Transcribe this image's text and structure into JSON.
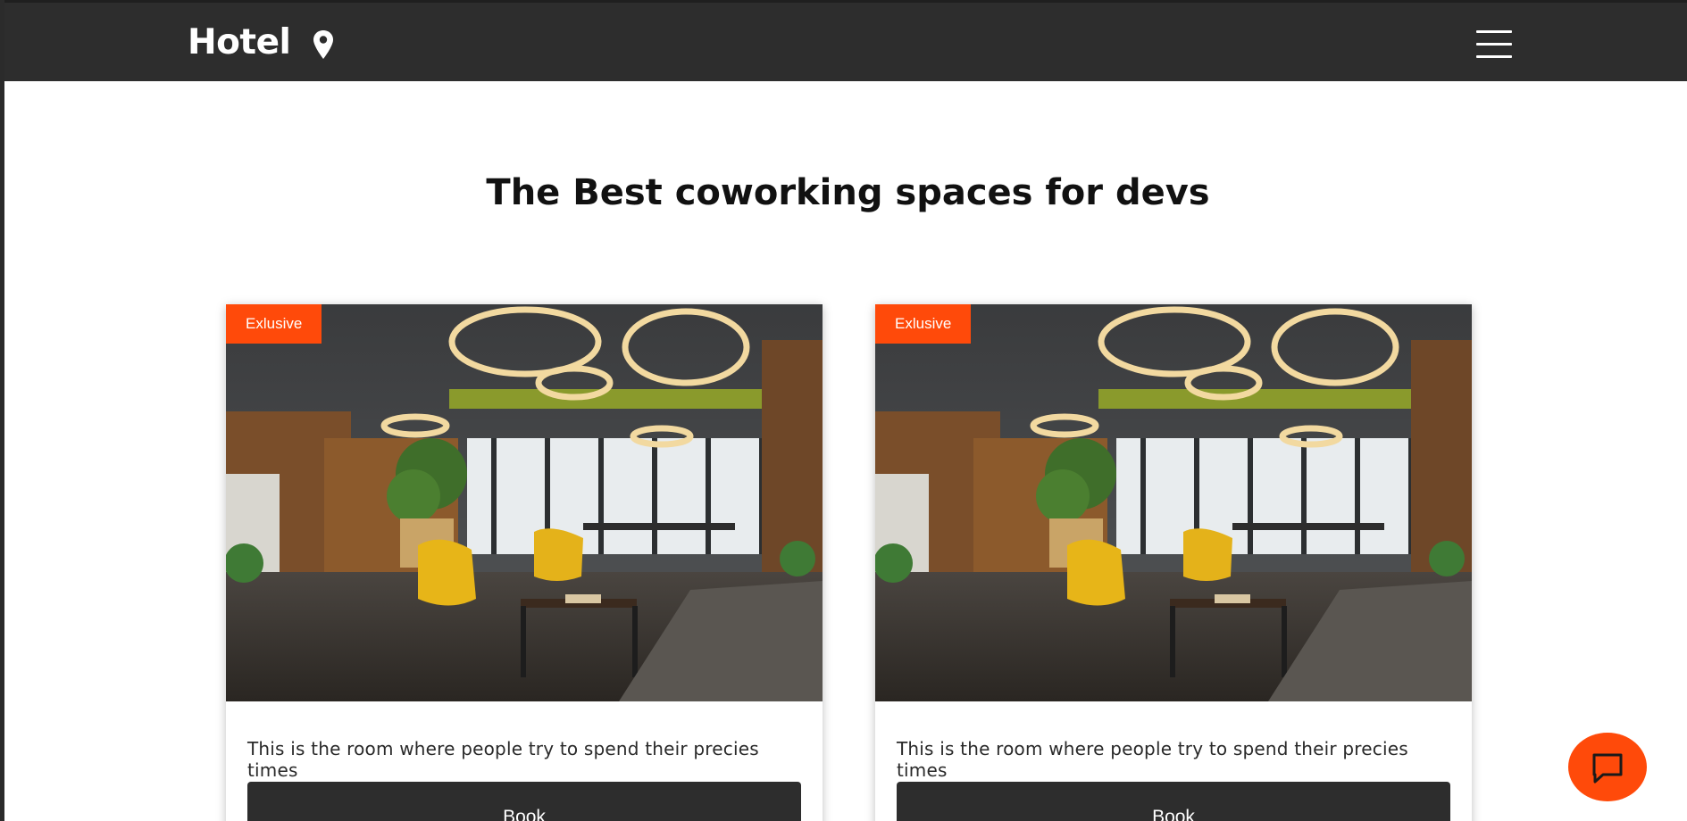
{
  "navbar": {
    "brand": "Hotel",
    "location_icon": "map-pin-icon",
    "menu_icon": "hamburger-menu-icon"
  },
  "main": {
    "title": "The Best coworking spaces for devs"
  },
  "cards": [
    {
      "badge": "Exlusive",
      "image_alt": "coworking lounge with yellow chairs",
      "description": "This is the room where people try to spend their precies times",
      "button_label": "Book"
    },
    {
      "badge": "Exlusive",
      "image_alt": "coworking lounge with yellow chairs",
      "description": "This is the room where people try to spend their precies times",
      "button_label": "Book"
    }
  ],
  "chat": {
    "icon": "chat-bubble-icon"
  },
  "colors": {
    "navbar_bg": "#2d2d2d",
    "accent": "#ff4a0a",
    "button_bg": "#2d2d2d"
  }
}
